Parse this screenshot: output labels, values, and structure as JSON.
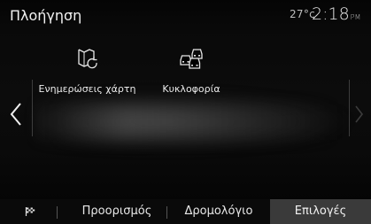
{
  "header": {
    "title": "Πλοήγηση",
    "temperature": "27°c",
    "time": "2:18",
    "ampm": "PM"
  },
  "tiles": [
    {
      "label": "Ενημερώσεις χάρτη",
      "icon": "map-refresh-icon"
    },
    {
      "label": "Κυκλοφορία",
      "icon": "traffic-cars-icon"
    }
  ],
  "bottom_bar": {
    "flag_icon": "flag-icon",
    "tabs": [
      "Προορισμός",
      "Δρομολόγιο",
      "Επιλογές"
    ],
    "active_tab": "Επιλογές"
  },
  "colors": {
    "background": "#0a0a0a",
    "active_tab": "#3a3a3a",
    "text": "#ececec"
  }
}
